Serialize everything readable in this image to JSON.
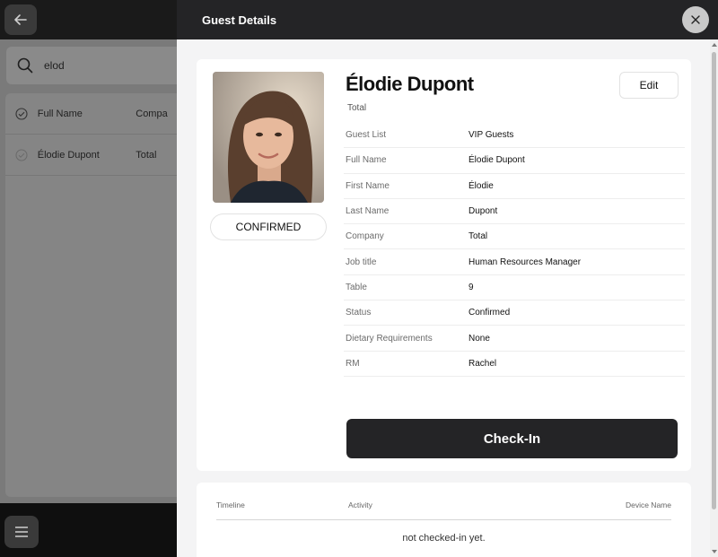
{
  "background": {
    "search": {
      "value": "elod"
    },
    "table": {
      "headers": [
        "Full Name",
        "Compa"
      ],
      "rows": [
        {
          "name": "Élodie Dupont",
          "company": "Total"
        }
      ]
    }
  },
  "drawer": {
    "title": "Guest Details",
    "guest": {
      "name": "Élodie Dupont",
      "company": "Total",
      "status_badge": "CONFIRMED"
    },
    "edit_label": "Edit",
    "details": [
      {
        "label": "Guest List",
        "value": "VIP Guests"
      },
      {
        "label": "Full Name",
        "value": "Élodie Dupont"
      },
      {
        "label": "First Name",
        "value": "Élodie"
      },
      {
        "label": "Last Name",
        "value": "Dupont"
      },
      {
        "label": "Company",
        "value": "Total"
      },
      {
        "label": "Job title",
        "value": "Human Resources Manager"
      },
      {
        "label": "Table",
        "value": "9"
      },
      {
        "label": "Status",
        "value": "Confirmed"
      },
      {
        "label": "Dietary Requirements",
        "value": "None"
      },
      {
        "label": "RM",
        "value": "Rachel"
      }
    ],
    "checkin_label": "Check-In",
    "timeline": {
      "headers": [
        "Timeline",
        "Activity",
        "Device Name"
      ],
      "empty_message": "not checked-in yet."
    }
  },
  "colors": {
    "header_dark": "#242426",
    "drawer_bg": "#f4f4f5",
    "overlay_gray": "#7a7a7a"
  },
  "icons": [
    "back-arrow-icon",
    "search-icon",
    "check-circle-icon",
    "menu-icon",
    "close-icon"
  ]
}
